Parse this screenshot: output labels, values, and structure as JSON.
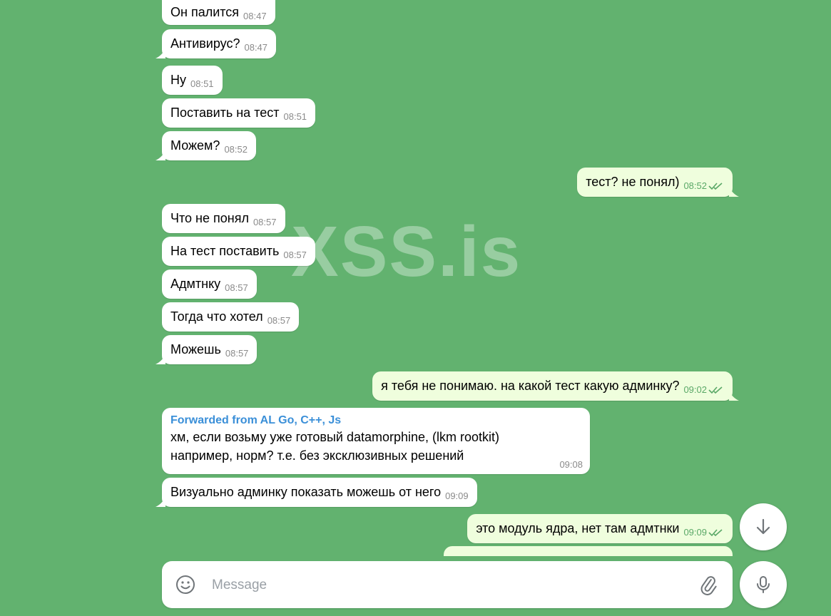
{
  "watermark": "XSS.is",
  "messages": [
    {
      "text": "Он палится",
      "time": "08:47",
      "dir": "in"
    },
    {
      "text": "Антивирус?",
      "time": "08:47",
      "dir": "in"
    },
    {
      "text": "Ну",
      "time": "08:51",
      "dir": "in"
    },
    {
      "text": "Поставить на тест",
      "time": "08:51",
      "dir": "in"
    },
    {
      "text": "Можем?",
      "time": "08:52",
      "dir": "in"
    },
    {
      "text": "тест? не понял)",
      "time": "08:52",
      "dir": "out"
    },
    {
      "text": "Что не понял",
      "time": "08:57",
      "dir": "in"
    },
    {
      "text": "На тест поставить",
      "time": "08:57",
      "dir": "in"
    },
    {
      "text": "Адмтнку",
      "time": "08:57",
      "dir": "in"
    },
    {
      "text": "Тогда что хотел",
      "time": "08:57",
      "dir": "in"
    },
    {
      "text": "Можешь",
      "time": "08:57",
      "dir": "in"
    },
    {
      "text": "я тебя не понимаю. на какой тест какую админку?",
      "time": "09:02",
      "dir": "out"
    },
    {
      "text": "Визуально админку показать можешь от него",
      "time": "09:09",
      "dir": "in"
    },
    {
      "text": "это модуль ядра, нет там адмтнки",
      "time": "09:09",
      "dir": "out"
    }
  ],
  "forwarded": {
    "header": "Forwarded from AL Go, C++, Js",
    "line1": "хм, если возьму уже готовый datamorphine, (lkm rootkit)",
    "line2": "например, норм? т.е. без эксклюзивных решений",
    "time": "09:08"
  },
  "composer": {
    "placeholder": "Message"
  },
  "icons": {
    "emoji": "emoji-icon",
    "attach": "paperclip-icon",
    "mic": "microphone-icon",
    "scroll_down": "arrow-down-icon"
  },
  "colors": {
    "background": "#62b26f",
    "incoming": "#ffffff",
    "outgoing": "#effedd",
    "forward_title": "#3a8fd8",
    "out_time": "#5aa867"
  }
}
